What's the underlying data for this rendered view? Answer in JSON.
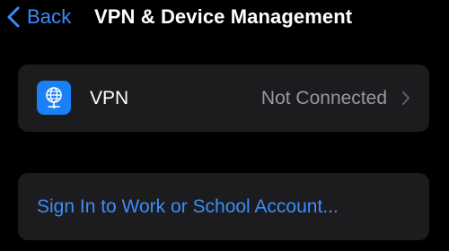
{
  "nav": {
    "back_label": "Back",
    "title": "VPN & Device Management",
    "back_icon": "chevron-left-icon"
  },
  "vpn_row": {
    "label": "VPN",
    "status": "Not Connected",
    "icon": "globe-network-icon",
    "icon_color": "#1a80f5",
    "chevron_icon": "chevron-right-icon"
  },
  "account_row": {
    "label": "Sign In to Work or School Account..."
  },
  "colors": {
    "background": "#000000",
    "cell": "#1c1c1e",
    "accent": "#3a8dfb",
    "secondary_text": "#98989e"
  }
}
